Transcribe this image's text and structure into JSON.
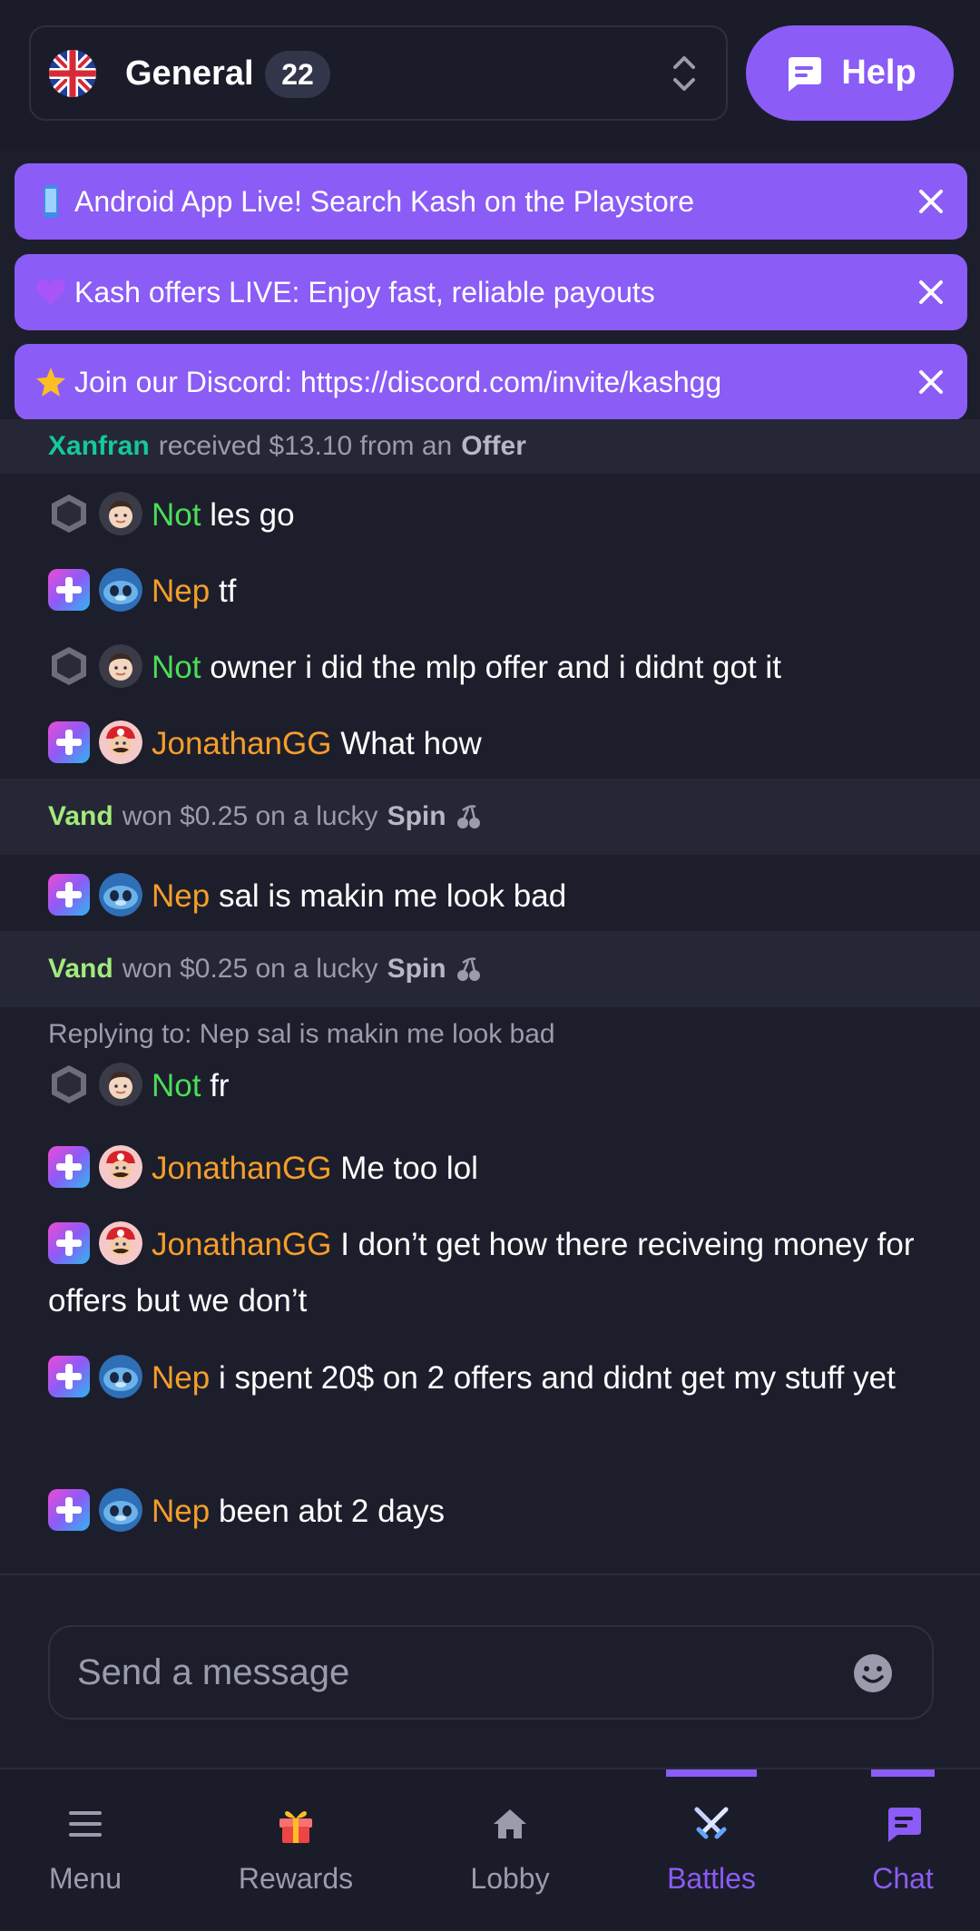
{
  "header": {
    "room_name": "General",
    "room_count": "22",
    "help_label": "Help"
  },
  "announcements": [
    {
      "icon": "phone-emoji",
      "text": "Android App Live! Search Kash on the Playstore"
    },
    {
      "icon": "purple-heart-emoji",
      "text": "Kash offers LIVE: Enjoy fast, reliable payouts"
    },
    {
      "icon": "star-emoji",
      "text": "Join our Discord: https://discord.com/invite/kashgg"
    }
  ],
  "chat": {
    "event1": {
      "user": "Xanfran",
      "text": "received $13.10 from an",
      "strong": "Offer"
    },
    "m1": {
      "user": "Not",
      "text": "les go"
    },
    "m2": {
      "user": "Nep",
      "text": "tf"
    },
    "m3": {
      "user": "Not",
      "text": "owner i did the mlp offer and i didnt got it"
    },
    "m4": {
      "user": "JonathanGG",
      "text": "What how"
    },
    "event2": {
      "user": "Vand",
      "text": "won $0.25 on a lucky",
      "strong": "Spin"
    },
    "m5": {
      "user": "Nep",
      "text": "sal is makin me look bad"
    },
    "event3": {
      "user": "Vand",
      "text": "won $0.25 on a lucky",
      "strong": "Spin"
    },
    "reply": "Replying to: Nep sal is makin me look bad",
    "m6": {
      "user": "Not",
      "text": "fr"
    },
    "m7": {
      "user": "JonathanGG",
      "text": "Me too lol"
    },
    "m8": {
      "user": "JonathanGG",
      "text": "I don’t get how there reciveing money for offers but we don’t"
    },
    "m9": {
      "user": "Nep",
      "text": "i spent 20$ on 2 offers and didnt get my stuff yet"
    },
    "m10": {
      "user": "Nep",
      "text": "been abt 2 days"
    }
  },
  "input": {
    "placeholder": "Send a message"
  },
  "nav": {
    "menu": "Menu",
    "rewards": "Rewards",
    "lobby": "Lobby",
    "battles": "Battles",
    "chat": "Chat"
  },
  "colors": {
    "accent": "#8b5cf6",
    "background": "#1d1e2c",
    "event_row": "#252736",
    "user_green": "#4ade58",
    "user_orange": "#f59e2a",
    "user_teal": "#14c7a0"
  }
}
